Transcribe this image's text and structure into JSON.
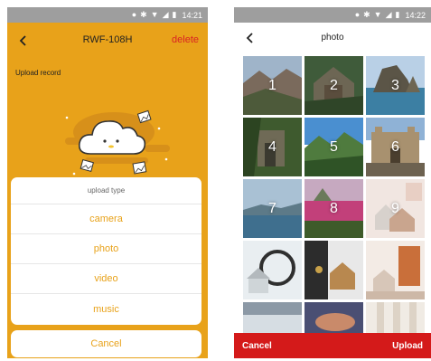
{
  "left_screen": {
    "status_time": "14:21",
    "device_title": "RWF-108H",
    "delete_label": "delete",
    "upload_record_label": "Upload record",
    "sheet": {
      "title": "upload type",
      "items": [
        "camera",
        "photo",
        "video",
        "music"
      ]
    },
    "cancel_label": "Cancel"
  },
  "right_screen": {
    "status_time": "14:22",
    "title": "photo",
    "photo_numbers": [
      "1",
      "2",
      "3",
      "4",
      "5",
      "6",
      "7",
      "8",
      "9"
    ],
    "cancel_label": "Cancel",
    "upload_label": "Upload"
  },
  "colors": {
    "accent_orange": "#e8a21a",
    "delete_red": "#d92323",
    "bottom_bar_red": "#d41a1a",
    "status_gray": "#9e9e9e"
  },
  "icons": {
    "status": [
      "location-icon",
      "bluetooth-icon",
      "wifi-icon",
      "signal-icon",
      "battery-icon"
    ],
    "back": "chevron-left-icon",
    "illustration": "cloud-mascot-icon"
  }
}
